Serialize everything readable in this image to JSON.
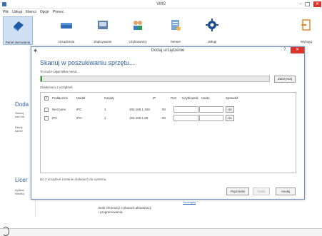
{
  "window": {
    "title": "VMS"
  },
  "menu": [
    "Plik",
    "Usługi",
    "Klienci",
    "Opcje",
    "Pomoc"
  ],
  "toolbar": [
    {
      "label": "Panel sterowania",
      "icon": "book-icon",
      "active": true
    },
    {
      "label": "Urządzenia",
      "icon": "dvr-device-icon",
      "active": false
    },
    {
      "label": "Zapisywanie",
      "icon": "recording-storage-icon",
      "active": false
    },
    {
      "label": "Użytkownicy",
      "icon": "users-icon",
      "active": false
    },
    {
      "label": "Serwer",
      "icon": "server-icon",
      "active": false
    },
    {
      "label": "Usługi",
      "icon": "gear-icon",
      "active": false
    },
    {
      "label": "Wyloguj",
      "icon": "logout-icon",
      "active": false
    }
  ],
  "background": {
    "heading1": "Doda",
    "text1": [
      "Skanuj",
      "sieć lok"
    ],
    "text2": [
      "Kliknij",
      "kamer"
    ],
    "heading2": "Licer",
    "text3": [
      "Aplikac",
      "Nieoficj"
    ],
    "link": "Szczegóły",
    "info": [
      "Brak informacji o planach aktualizacji",
      "i programowania."
    ]
  },
  "dialog": {
    "title": "Dodaj urządzenie",
    "help": "?",
    "heading": "Skanuj w poszukiwaniu sprzętu...",
    "subtitle": "To może zająć kilka minut.",
    "progress_fraction": 0.006,
    "stop_label": "Zatrzymaj",
    "found_text": "Znaleziono 2 urządzeń",
    "columns": {
      "connect": "Podłączeni",
      "model": "Model",
      "channels": "Kanały",
      "ip": "IP",
      "port": "Port",
      "user": "Użytkownik",
      "password": "Hasło",
      "verify": "Sprawdź"
    },
    "rows": [
      {
        "name": "Nieznane",
        "model": "IPC",
        "channels": "1",
        "ip": "192.168.1.169",
        "port": "80",
        "ok": "OK"
      },
      {
        "name": "IPC",
        "model": "IPC",
        "channels": "1",
        "ip": "192.168.1.88",
        "port": "80",
        "ok": "OK"
      }
    ],
    "note": "Do 2 urządzeń zostanie dodanych do systemu.",
    "buttons": {
      "prev": "Poprzedni",
      "next": "Dalej",
      "cancel": "Anuluj"
    }
  },
  "colors": {
    "accent": "#2e5fa3",
    "progress": "#2aa02a",
    "close": "#d9352c"
  }
}
